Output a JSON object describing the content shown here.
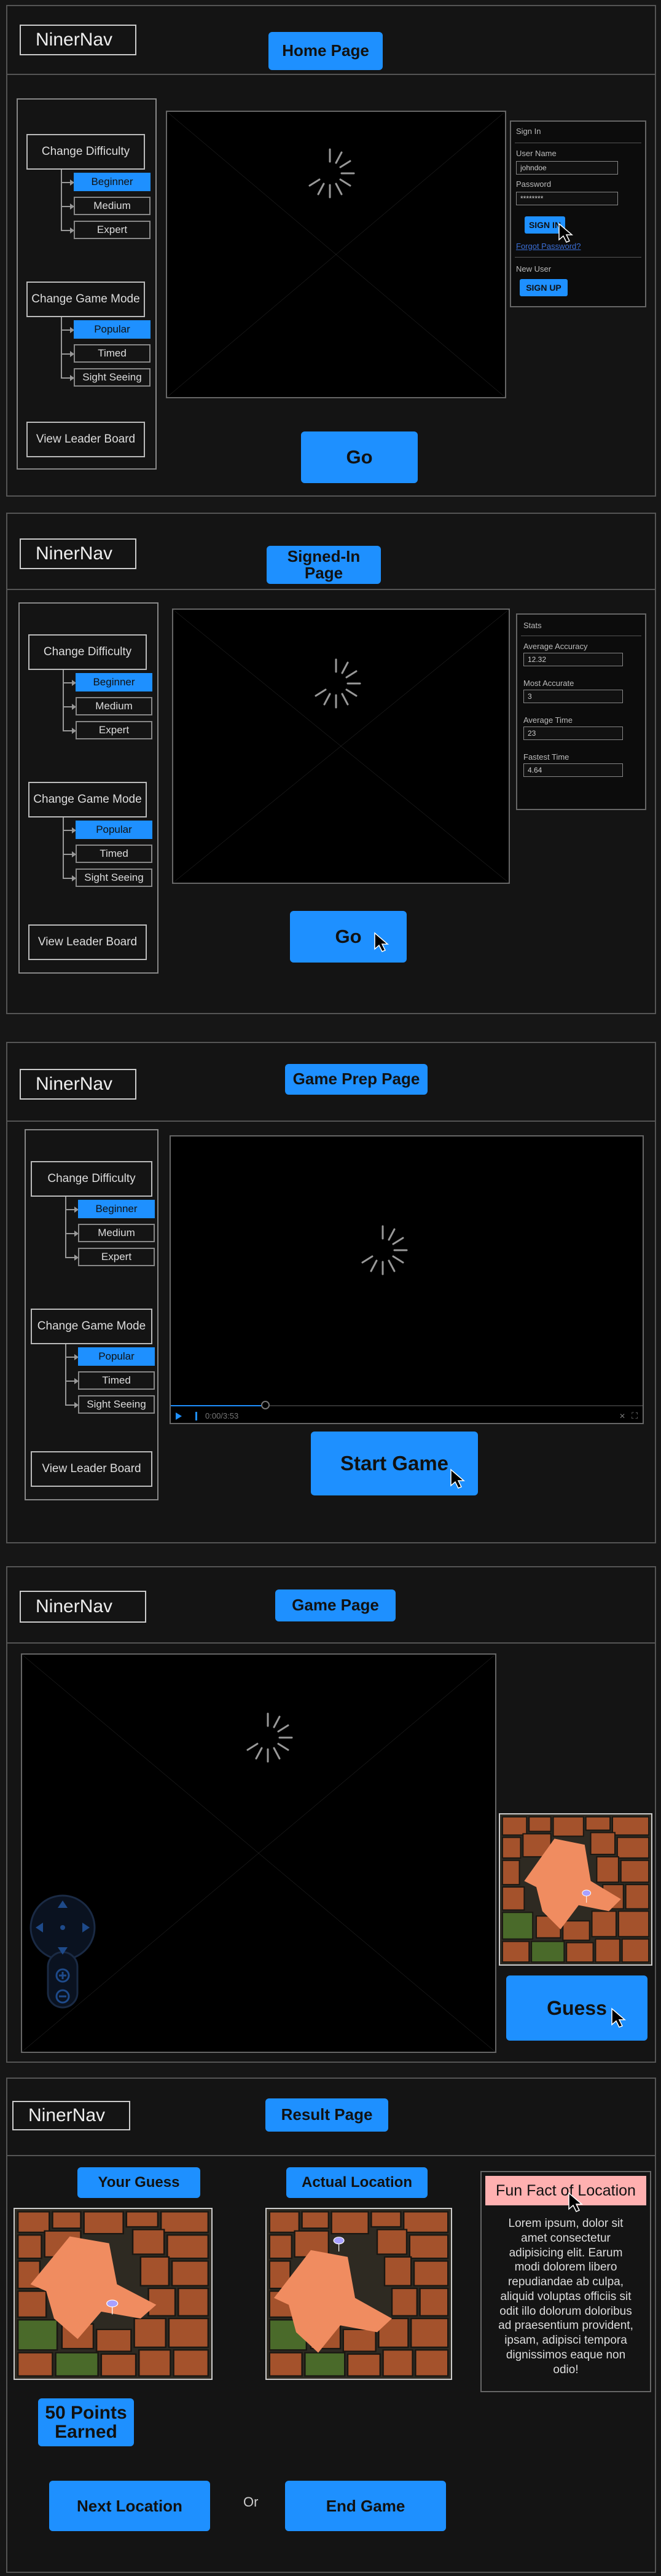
{
  "app": {
    "logo": "NinerNav"
  },
  "sidebar": {
    "difficulty_label": "Change Difficulty",
    "difficulties": [
      "Beginner",
      "Medium",
      "Expert"
    ],
    "mode_label": "Change Game Mode",
    "modes": [
      "Popular",
      "Timed",
      "Sight Seeing"
    ],
    "leaderboard_label": "View Leader Board",
    "selected_difficulty": "Beginner",
    "selected_mode": "Popular"
  },
  "home": {
    "title": "Home Page",
    "go_label": "Go",
    "signin": {
      "heading": "Sign In",
      "username_label": "User Name",
      "username_value": "johndoe",
      "password_label": "Password",
      "password_value": "********",
      "signin_button": "SIGN IN",
      "forgot_link": "Forgot Password?",
      "new_user_label": "New User",
      "signup_button": "SIGN UP"
    }
  },
  "signed_in": {
    "title": "Signed-In Page",
    "go_label": "Go",
    "stats": {
      "heading": "Stats",
      "avg_accuracy_label": "Average Accuracy",
      "avg_accuracy_value": "12.32",
      "most_accurate_label": "Most Accurate",
      "most_accurate_value": "3",
      "avg_time_label": "Average Time",
      "avg_time_value": "23",
      "fastest_time_label": "Fastest Time",
      "fastest_time_value": "4.64"
    }
  },
  "prep": {
    "title": "Game Prep Page",
    "start_label": "Start Game",
    "video_time": "0:00/3:53",
    "progress": 0.2
  },
  "game": {
    "title": "Game Page",
    "guess_label": "Guess"
  },
  "result": {
    "title": "Result Page",
    "your_guess_label": "Your Guess",
    "actual_label": "Actual Location",
    "fun_fact_title": "Fun Fact of Location",
    "fun_fact_text": "Lorem ipsum, dolor sit amet consectetur adipisicing elit. Earum modi dolorem libero repudiandae ab culpa, aliquid voluptas officiis sit odit illo dolorum doloribus ad praesentium provident, ipsam, adipisci tempora dignissimos eaque non odio!",
    "points_label": "50 Points Earned",
    "next_label": "Next Location",
    "or_label": "Or",
    "end_label": "End Game"
  },
  "colors": {
    "accent": "#1e90ff",
    "background": "#141414",
    "fact_header": "#ffb0b0"
  }
}
